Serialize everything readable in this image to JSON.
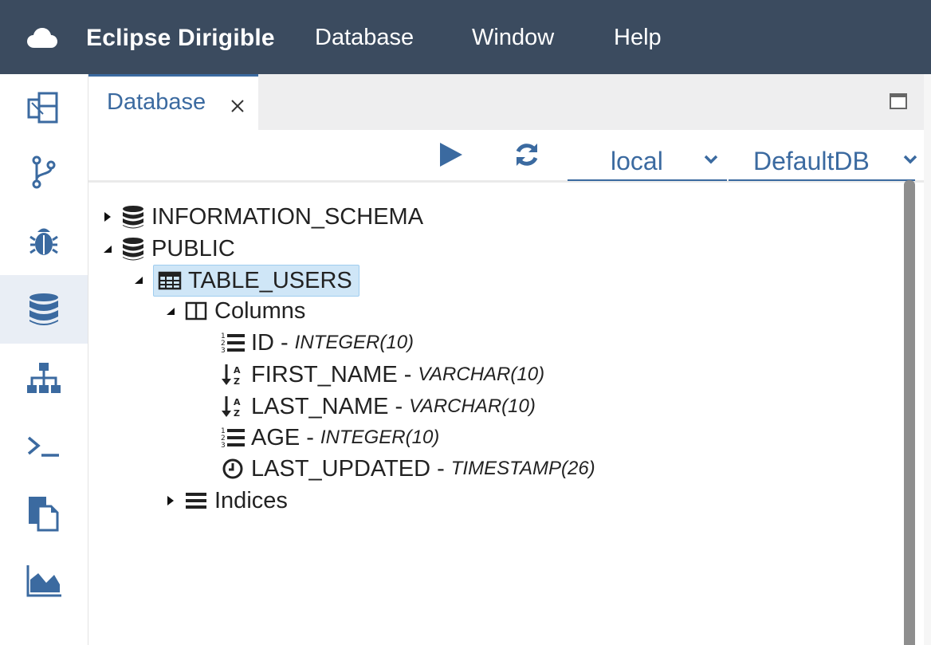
{
  "menubar": {
    "brand": "Eclipse Dirigible",
    "menus": [
      "Database",
      "Window",
      "Help"
    ]
  },
  "sidebar": {
    "items": [
      {
        "icon": "files-icon"
      },
      {
        "icon": "git-branch-icon"
      },
      {
        "icon": "bug-icon"
      },
      {
        "icon": "database-icon",
        "active": true
      },
      {
        "icon": "sitemap-icon"
      },
      {
        "icon": "terminal-icon"
      },
      {
        "icon": "documents-icon"
      },
      {
        "icon": "area-chart-icon"
      }
    ]
  },
  "tab": {
    "label": "Database"
  },
  "toolbar": {
    "connection": "local",
    "database": "DefaultDB"
  },
  "tree": {
    "schemas": [
      {
        "name": "INFORMATION_SCHEMA",
        "expanded": false
      },
      {
        "name": "PUBLIC",
        "expanded": true
      }
    ],
    "table": {
      "name": "TABLE_USERS"
    },
    "columns_label": "Columns",
    "columns": [
      {
        "name": "ID",
        "type": "INTEGER(10)",
        "icon": "numbered-list-icon"
      },
      {
        "name": "FIRST_NAME",
        "type": "VARCHAR(10)",
        "icon": "sort-alpha-icon"
      },
      {
        "name": "LAST_NAME",
        "type": "VARCHAR(10)",
        "icon": "sort-alpha-icon"
      },
      {
        "name": "AGE",
        "type": "INTEGER(10)",
        "icon": "numbered-list-icon"
      },
      {
        "name": "LAST_UPDATED",
        "type": "TIMESTAMP(26)",
        "icon": "clock-icon"
      }
    ],
    "indices_label": "Indices",
    "separator": "-"
  },
  "colors": {
    "menubar": "#3b4b5f",
    "accent": "#3b6aa0",
    "selection": "#cfe6f7"
  }
}
